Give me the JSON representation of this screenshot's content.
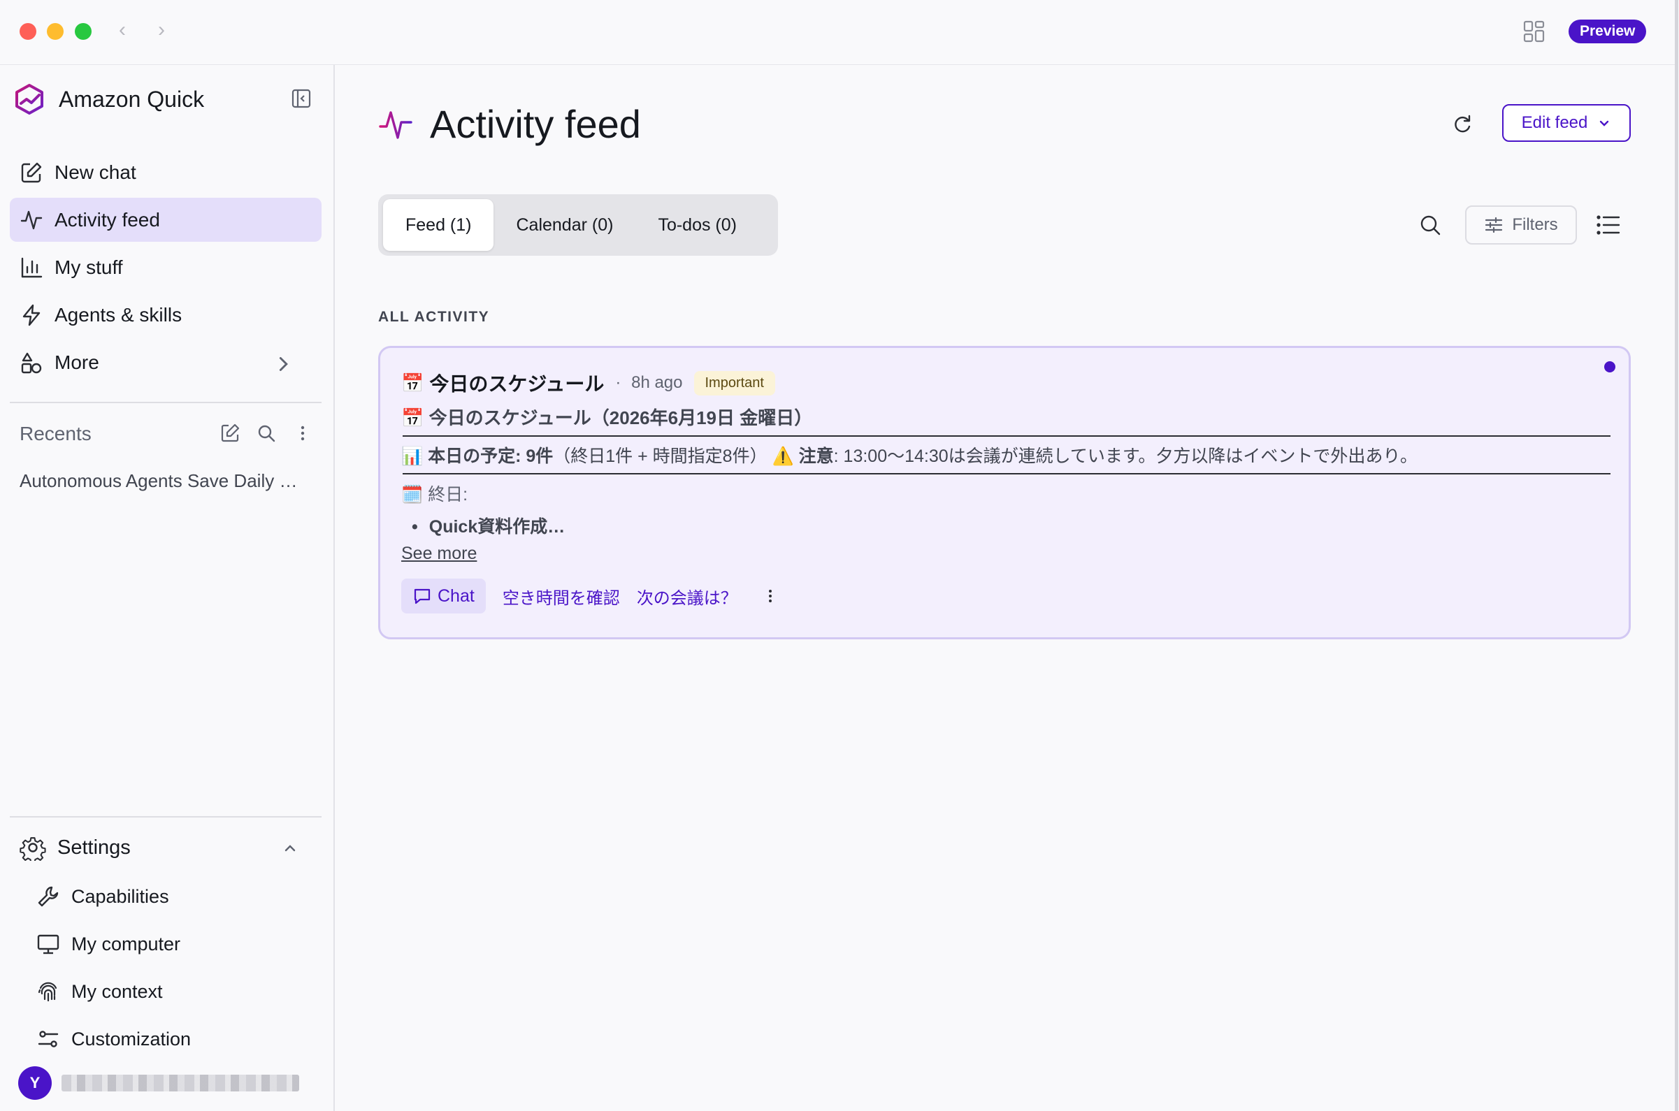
{
  "window": {
    "preview_label": "Preview"
  },
  "sidebar": {
    "brand_name": "Amazon Quick",
    "nav_items": [
      {
        "label": "New chat",
        "icon": "edit-icon"
      },
      {
        "label": "Activity feed",
        "icon": "activity-icon",
        "active": true
      },
      {
        "label": "My stuff",
        "icon": "bar-chart-icon"
      },
      {
        "label": "Agents & skills",
        "icon": "lightning-icon"
      },
      {
        "label": "More",
        "icon": "shapes-icon"
      }
    ],
    "recents_label": "Recents",
    "recent_items": [
      "Autonomous Agents Save Daily …"
    ],
    "settings_label": "Settings",
    "settings_items": [
      {
        "label": "Capabilities",
        "icon": "wrench-icon"
      },
      {
        "label": "My computer",
        "icon": "monitor-icon"
      },
      {
        "label": "My context",
        "icon": "fingerprint-icon"
      },
      {
        "label": "Customization",
        "icon": "sliders-icon"
      }
    ],
    "user_initial": "Y"
  },
  "main": {
    "title": "Activity feed",
    "edit_feed_label": "Edit feed",
    "tabs": [
      {
        "label": "Feed (1)",
        "active": true
      },
      {
        "label": "Calendar (0)"
      },
      {
        "label": "To-dos (0)"
      }
    ],
    "filters_label": "Filters",
    "section_label": "ALL ACTIVITY",
    "card": {
      "emoji": "📅",
      "title": "今日のスケジュール",
      "time": "8h ago",
      "tag": "Important",
      "subtitle": "📅 今日のスケジュール（2026年6月19日 金曜日）",
      "summary_icon": "📊",
      "summary_bold": "本日の予定: 9件",
      "summary_text": "（終日1件 + 時間指定8件）",
      "warning_icon": "⚠️",
      "warning_bold": "注意",
      "warning_text": ": 13:00〜14:30は会議が連続しています。夕方以降はイベントで外出あり。",
      "allday_label": "🗓️ 終日:",
      "bullet": "Quick資料作成…",
      "see_more": "See more",
      "chat_label": "Chat",
      "prompt1": "空き時間を確認",
      "prompt2": "次の会議は？"
    }
  },
  "colors": {
    "accent": "#4a14c8",
    "active_nav_bg": "#e4defa",
    "card_bg": "#f3effd",
    "important_tag_bg": "#fbf3d8"
  }
}
